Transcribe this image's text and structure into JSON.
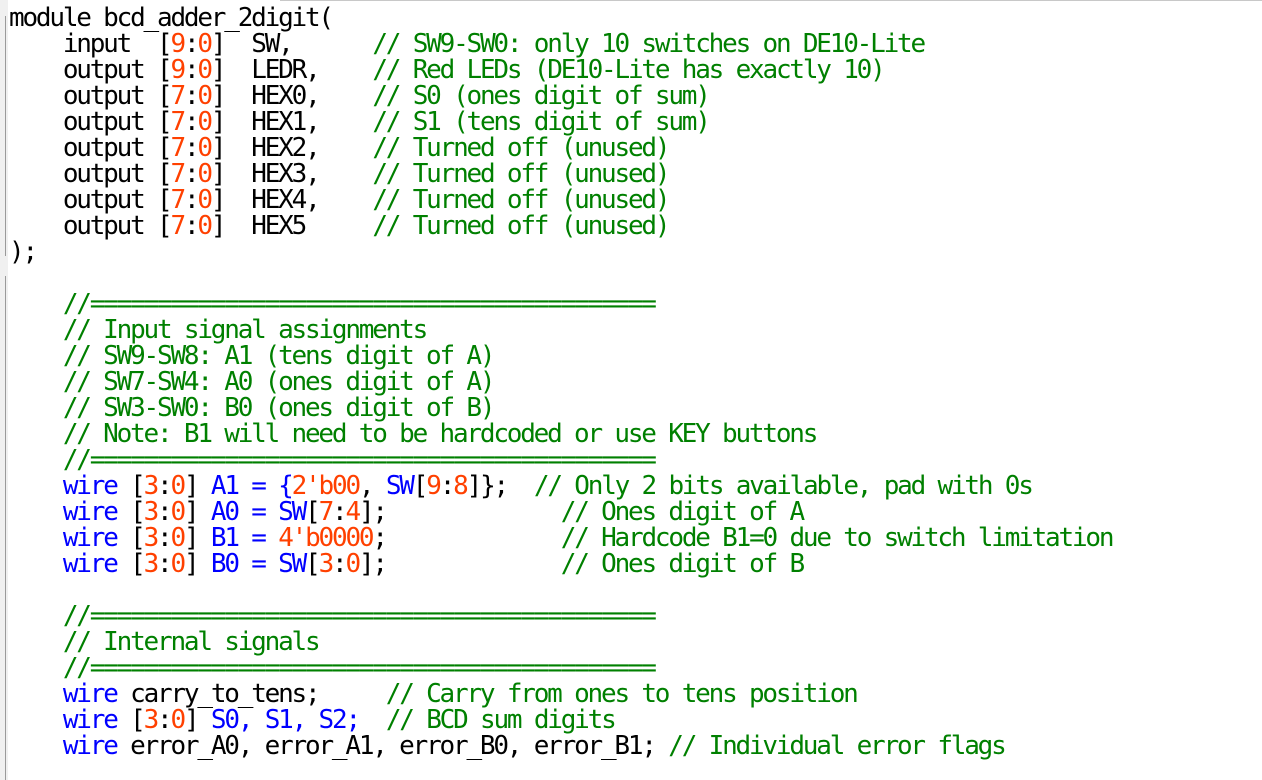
{
  "editor": {
    "lines": [
      [
        {
          "t": "module bcd_adder_2digit(",
          "c": "tx"
        }
      ],
      [
        {
          "t": "    input  ",
          "c": "tx"
        },
        {
          "t": "[",
          "c": "br"
        },
        {
          "t": "9",
          "c": "num"
        },
        {
          "t": ":",
          "c": "br"
        },
        {
          "t": "0",
          "c": "num"
        },
        {
          "t": "]",
          "c": "br"
        },
        {
          "t": "  SW,      ",
          "c": "tx"
        },
        {
          "t": "// SW9-SW0: only 10 switches on DE10-Lite",
          "c": "cm"
        }
      ],
      [
        {
          "t": "    output ",
          "c": "tx"
        },
        {
          "t": "[",
          "c": "br"
        },
        {
          "t": "9",
          "c": "num"
        },
        {
          "t": ":",
          "c": "br"
        },
        {
          "t": "0",
          "c": "num"
        },
        {
          "t": "]",
          "c": "br"
        },
        {
          "t": "  LEDR,    ",
          "c": "tx"
        },
        {
          "t": "// Red LEDs (DE10-Lite has exactly 10)",
          "c": "cm"
        }
      ],
      [
        {
          "t": "    output ",
          "c": "tx"
        },
        {
          "t": "[",
          "c": "br"
        },
        {
          "t": "7",
          "c": "num"
        },
        {
          "t": ":",
          "c": "br"
        },
        {
          "t": "0",
          "c": "num"
        },
        {
          "t": "]",
          "c": "br"
        },
        {
          "t": "  HEX0,    ",
          "c": "tx"
        },
        {
          "t": "// S0 (ones digit of sum)",
          "c": "cm"
        }
      ],
      [
        {
          "t": "    output ",
          "c": "tx"
        },
        {
          "t": "[",
          "c": "br"
        },
        {
          "t": "7",
          "c": "num"
        },
        {
          "t": ":",
          "c": "br"
        },
        {
          "t": "0",
          "c": "num"
        },
        {
          "t": "]",
          "c": "br"
        },
        {
          "t": "  HEX1,    ",
          "c": "tx"
        },
        {
          "t": "// S1 (tens digit of sum)",
          "c": "cm"
        }
      ],
      [
        {
          "t": "    output ",
          "c": "tx"
        },
        {
          "t": "[",
          "c": "br"
        },
        {
          "t": "7",
          "c": "num"
        },
        {
          "t": ":",
          "c": "br"
        },
        {
          "t": "0",
          "c": "num"
        },
        {
          "t": "]",
          "c": "br"
        },
        {
          "t": "  HEX2,    ",
          "c": "tx"
        },
        {
          "t": "// Turned off (unused)",
          "c": "cm"
        }
      ],
      [
        {
          "t": "    output ",
          "c": "tx"
        },
        {
          "t": "[",
          "c": "br"
        },
        {
          "t": "7",
          "c": "num"
        },
        {
          "t": ":",
          "c": "br"
        },
        {
          "t": "0",
          "c": "num"
        },
        {
          "t": "]",
          "c": "br"
        },
        {
          "t": "  HEX3,    ",
          "c": "tx"
        },
        {
          "t": "// Turned off (unused)",
          "c": "cm"
        }
      ],
      [
        {
          "t": "    output ",
          "c": "tx"
        },
        {
          "t": "[",
          "c": "br"
        },
        {
          "t": "7",
          "c": "num"
        },
        {
          "t": ":",
          "c": "br"
        },
        {
          "t": "0",
          "c": "num"
        },
        {
          "t": "]",
          "c": "br"
        },
        {
          "t": "  HEX4,    ",
          "c": "tx"
        },
        {
          "t": "// Turned off (unused)",
          "c": "cm"
        }
      ],
      [
        {
          "t": "    output ",
          "c": "tx"
        },
        {
          "t": "[",
          "c": "br"
        },
        {
          "t": "7",
          "c": "num"
        },
        {
          "t": ":",
          "c": "br"
        },
        {
          "t": "0",
          "c": "num"
        },
        {
          "t": "]",
          "c": "br"
        },
        {
          "t": "  HEX5     ",
          "c": "tx"
        },
        {
          "t": "// Turned off (unused)",
          "c": "cm"
        }
      ],
      [
        {
          "t": ");",
          "c": "tx"
        }
      ],
      [],
      [
        {
          "t": "    //==========================================",
          "c": "cm"
        }
      ],
      [
        {
          "t": "    // Input signal assignments",
          "c": "cm"
        }
      ],
      [
        {
          "t": "    // SW9-SW8: A1 (tens digit of A)",
          "c": "cm"
        }
      ],
      [
        {
          "t": "    // SW7-SW4: A0 (ones digit of A)",
          "c": "cm"
        }
      ],
      [
        {
          "t": "    // SW3-SW0: B0 (ones digit of B)",
          "c": "cm"
        }
      ],
      [
        {
          "t": "    // Note: B1 will need to be hardcoded or use KEY buttons",
          "c": "cm"
        }
      ],
      [
        {
          "t": "    //==========================================",
          "c": "cm"
        }
      ],
      [
        {
          "t": "    ",
          "c": "tx"
        },
        {
          "t": "wire",
          "c": "kw"
        },
        {
          "t": " [",
          "c": "br"
        },
        {
          "t": "3",
          "c": "num"
        },
        {
          "t": ":",
          "c": "br"
        },
        {
          "t": "0",
          "c": "num"
        },
        {
          "t": "] ",
          "c": "br"
        },
        {
          "t": "A1 = {",
          "c": "kw"
        },
        {
          "t": "2'b00",
          "c": "num"
        },
        {
          "t": ", ",
          "c": "tx"
        },
        {
          "t": "SW",
          "c": "kw"
        },
        {
          "t": "[",
          "c": "br"
        },
        {
          "t": "9",
          "c": "num"
        },
        {
          "t": ":",
          "c": "br"
        },
        {
          "t": "8",
          "c": "num"
        },
        {
          "t": "]};  ",
          "c": "tx"
        },
        {
          "t": "// Only 2 bits available, pad with 0s",
          "c": "cm"
        }
      ],
      [
        {
          "t": "    ",
          "c": "tx"
        },
        {
          "t": "wire",
          "c": "kw"
        },
        {
          "t": " [",
          "c": "br"
        },
        {
          "t": "3",
          "c": "num"
        },
        {
          "t": ":",
          "c": "br"
        },
        {
          "t": "0",
          "c": "num"
        },
        {
          "t": "] ",
          "c": "br"
        },
        {
          "t": "A0 = SW",
          "c": "kw"
        },
        {
          "t": "[",
          "c": "br"
        },
        {
          "t": "7",
          "c": "num"
        },
        {
          "t": ":",
          "c": "br"
        },
        {
          "t": "4",
          "c": "num"
        },
        {
          "t": "];             ",
          "c": "tx"
        },
        {
          "t": "// Ones digit of A",
          "c": "cm"
        }
      ],
      [
        {
          "t": "    ",
          "c": "tx"
        },
        {
          "t": "wire",
          "c": "kw"
        },
        {
          "t": " [",
          "c": "br"
        },
        {
          "t": "3",
          "c": "num"
        },
        {
          "t": ":",
          "c": "br"
        },
        {
          "t": "0",
          "c": "num"
        },
        {
          "t": "] ",
          "c": "br"
        },
        {
          "t": "B1 = ",
          "c": "kw"
        },
        {
          "t": "4'b0000",
          "c": "num"
        },
        {
          "t": ";             ",
          "c": "tx"
        },
        {
          "t": "// Hardcode B1=0 due to switch limitation",
          "c": "cm"
        }
      ],
      [
        {
          "t": "    ",
          "c": "tx"
        },
        {
          "t": "wire",
          "c": "kw"
        },
        {
          "t": " [",
          "c": "br"
        },
        {
          "t": "3",
          "c": "num"
        },
        {
          "t": ":",
          "c": "br"
        },
        {
          "t": "0",
          "c": "num"
        },
        {
          "t": "] ",
          "c": "br"
        },
        {
          "t": "B0 = SW",
          "c": "kw"
        },
        {
          "t": "[",
          "c": "br"
        },
        {
          "t": "3",
          "c": "num"
        },
        {
          "t": ":",
          "c": "br"
        },
        {
          "t": "0",
          "c": "num"
        },
        {
          "t": "];             ",
          "c": "tx"
        },
        {
          "t": "// Ones digit of B",
          "c": "cm"
        }
      ],
      [],
      [
        {
          "t": "    //==========================================",
          "c": "cm"
        }
      ],
      [
        {
          "t": "    // Internal signals",
          "c": "cm"
        }
      ],
      [
        {
          "t": "    //==========================================",
          "c": "cm"
        }
      ],
      [
        {
          "t": "    ",
          "c": "tx"
        },
        {
          "t": "wire",
          "c": "kw"
        },
        {
          "t": " carry_to_tens;     ",
          "c": "tx"
        },
        {
          "t": "// Carry from ones to tens position",
          "c": "cm"
        }
      ],
      [
        {
          "t": "    ",
          "c": "tx"
        },
        {
          "t": "wire",
          "c": "kw"
        },
        {
          "t": " [",
          "c": "br"
        },
        {
          "t": "3",
          "c": "num"
        },
        {
          "t": ":",
          "c": "br"
        },
        {
          "t": "0",
          "c": "num"
        },
        {
          "t": "] ",
          "c": "br"
        },
        {
          "t": "S0, S1, S2;",
          "c": "kw"
        },
        {
          "t": "  ",
          "c": "tx"
        },
        {
          "t": "// BCD sum digits",
          "c": "cm"
        }
      ],
      [
        {
          "t": "    ",
          "c": "tx"
        },
        {
          "t": "wire",
          "c": "kw"
        },
        {
          "t": " error_A0, error_A1, error_B0, error_B1; ",
          "c": "tx"
        },
        {
          "t": "// Individual error flags",
          "c": "cm"
        }
      ]
    ]
  }
}
